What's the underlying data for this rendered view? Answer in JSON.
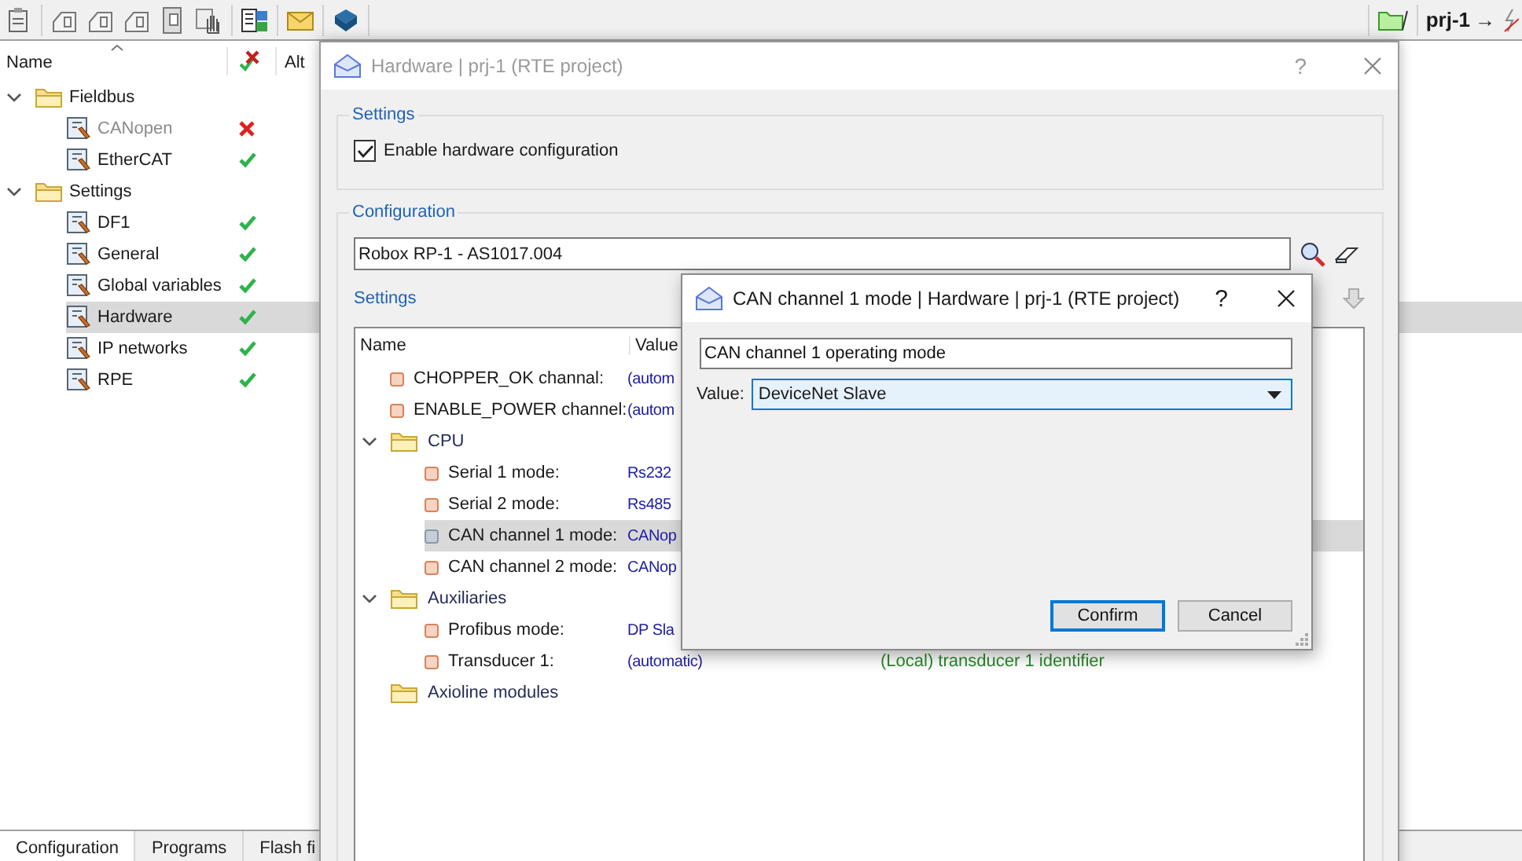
{
  "toolbar": {
    "project": "prj-1",
    "arrow": "→"
  },
  "project_tree": {
    "columns": [
      "Name",
      "Alt"
    ],
    "items": [
      {
        "label": "Fieldbus",
        "expanded": true,
        "children": [
          {
            "label": "CANopen",
            "ok": false,
            "disabled": true,
            "selected": false
          },
          {
            "label": "EtherCAT",
            "ok": true,
            "disabled": false,
            "selected": false
          }
        ]
      },
      {
        "label": "Settings",
        "expanded": true,
        "children": [
          {
            "label": "DF1",
            "ok": true,
            "disabled": false,
            "selected": false
          },
          {
            "label": "General",
            "ok": true,
            "disabled": false,
            "selected": false
          },
          {
            "label": "Global variables",
            "ok": true,
            "disabled": false,
            "selected": false
          },
          {
            "label": "Hardware",
            "ok": true,
            "disabled": false,
            "selected": true
          },
          {
            "label": "IP networks",
            "ok": true,
            "disabled": false,
            "selected": false
          },
          {
            "label": "RPE",
            "ok": true,
            "disabled": false,
            "selected": false
          }
        ]
      }
    ]
  },
  "bottom_tabs": [
    {
      "label": "Configuration",
      "selected": true
    },
    {
      "label": "Programs",
      "selected": false
    },
    {
      "label": "Flash fi",
      "selected": false
    }
  ],
  "hardware_window": {
    "title": "Hardware | prj-1 (RTE project)",
    "help": "?",
    "settings_group": {
      "title": "Settings",
      "checkbox": {
        "label": "Enable hardware configuration",
        "checked": true
      }
    },
    "configuration_group": {
      "title": "Configuration",
      "device": "Robox RP-1 - AS1017.004",
      "settings_label": "Settings",
      "columns": [
        "Name",
        "Value"
      ],
      "rows": [
        {
          "kind": "item",
          "name": "CHOPPER_OK channal:",
          "value": "(autom",
          "selected": false
        },
        {
          "kind": "item",
          "name": "ENABLE_POWER channel:",
          "value": "(autom",
          "selected": false
        },
        {
          "kind": "group",
          "name": "CPU",
          "expanded": true,
          "children": [
            {
              "kind": "item",
              "name": "Serial 1 mode:",
              "value": "Rs232",
              "selected": false
            },
            {
              "kind": "item",
              "name": "Serial 2 mode:",
              "value": "Rs485",
              "selected": false
            },
            {
              "kind": "item",
              "name": "CAN channel 1 mode:",
              "value": "CANop",
              "selected": true
            },
            {
              "kind": "item",
              "name": "CAN channel 2 mode:",
              "value": "CANop",
              "selected": false
            }
          ]
        },
        {
          "kind": "group",
          "name": "Auxiliaries",
          "expanded": true,
          "children": [
            {
              "kind": "item",
              "name": "Profibus mode:",
              "value": "DP Sla",
              "selected": false
            },
            {
              "kind": "item",
              "name": "Transducer 1:",
              "value": "(automatic)",
              "note": "(Local) transducer 1 identifier",
              "selected": false
            }
          ]
        },
        {
          "kind": "group",
          "name": "Axioline modules"
        }
      ]
    }
  },
  "mode_dialog": {
    "title": "CAN channel 1 mode | Hardware | prj-1 (RTE project)",
    "help": "?",
    "description": "CAN channel 1 operating mode",
    "value_label": "Value:",
    "value": "DeviceNet Slave",
    "buttons": [
      {
        "label": "Confirm",
        "default": true
      },
      {
        "label": "Cancel",
        "default": false
      }
    ]
  }
}
